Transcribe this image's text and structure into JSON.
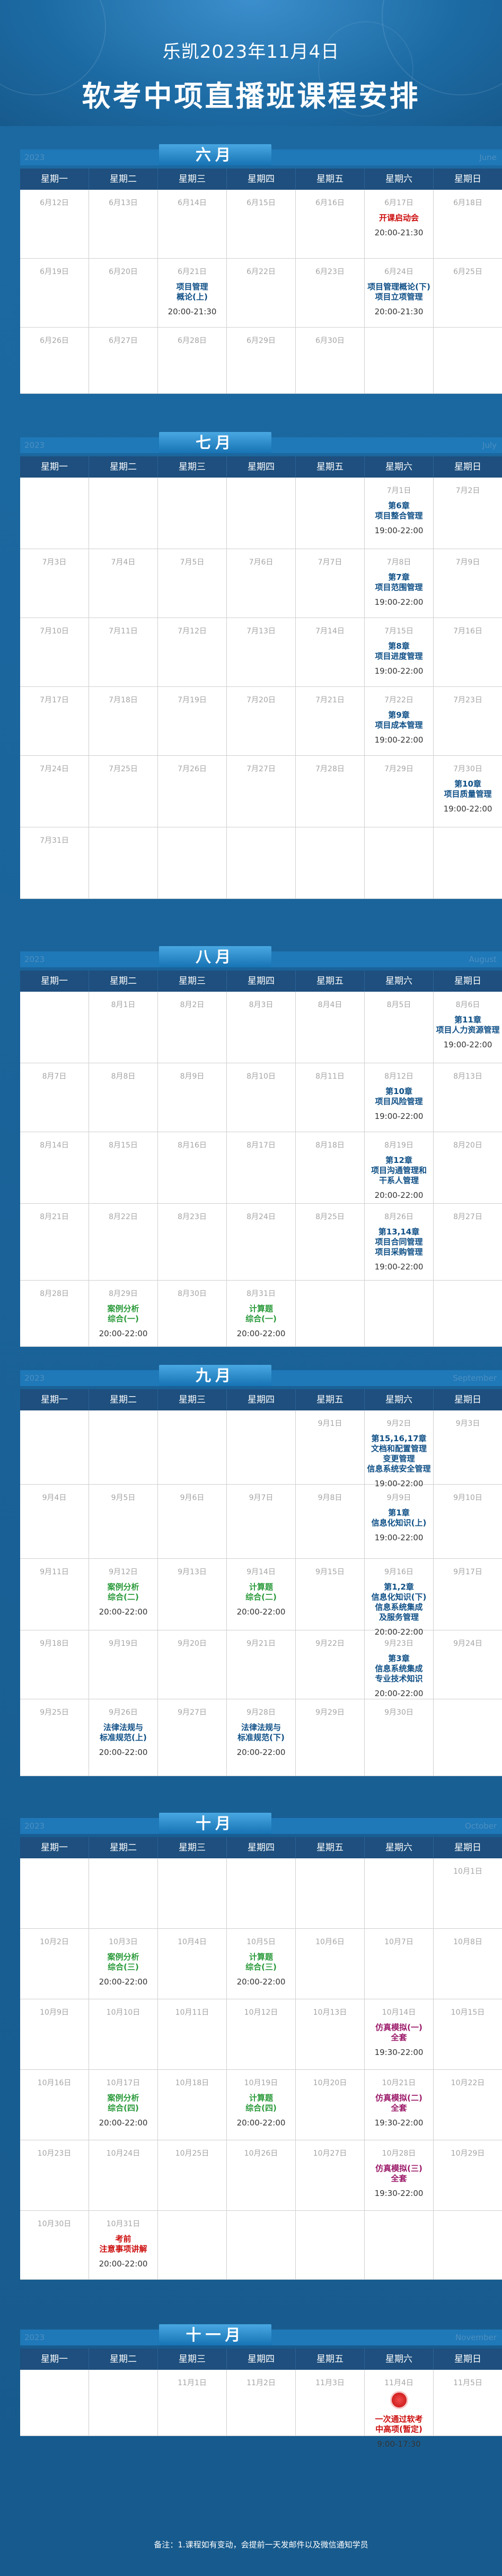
{
  "header": {
    "subtitle": "乐凯2023年11月4日",
    "title": "软考中项直播班课程安排"
  },
  "weekdays": [
    "星期一",
    "星期二",
    "星期三",
    "星期四",
    "星期五",
    "星期六",
    "星期日"
  ],
  "months": [
    {
      "id": "june",
      "name": "六月",
      "year": "2023",
      "en": "June",
      "rows": [
        [
          {
            "d": "6月12日"
          },
          {
            "d": "6月13日"
          },
          {
            "d": "6月14日"
          },
          {
            "d": "6月15日"
          },
          {
            "d": "6月16日"
          },
          {
            "d": "6月17日",
            "ev": "开课启动会",
            "c": "red",
            "t": "20:00-21:30"
          },
          {
            "d": "6月18日"
          }
        ],
        [
          {
            "d": "6月19日"
          },
          {
            "d": "6月20日"
          },
          {
            "d": "6月21日",
            "ev": "项目管理\n概论(上)",
            "c": "blue",
            "t": "20:00-21:30"
          },
          {
            "d": "6月22日"
          },
          {
            "d": "6月23日"
          },
          {
            "d": "6月24日",
            "ev": "项目管理概论(下)\n项目立项管理",
            "c": "blue",
            "t": "20:00-21:30"
          },
          {
            "d": "6月25日"
          }
        ],
        [
          {
            "d": "6月26日"
          },
          {
            "d": "6月27日"
          },
          {
            "d": "6月28日"
          },
          {
            "d": "6月29日"
          },
          {
            "d": "6月30日"
          },
          {},
          {}
        ]
      ]
    },
    {
      "id": "july",
      "name": "七月",
      "year": "2023",
      "en": "July",
      "rows": [
        [
          {},
          {},
          {},
          {},
          {},
          {
            "d": "7月1日",
            "ev": "第6章\n项目整合管理",
            "c": "blue",
            "t": "19:00-22:00"
          },
          {
            "d": "7月2日"
          }
        ],
        [
          {
            "d": "7月3日"
          },
          {
            "d": "7月4日"
          },
          {
            "d": "7月5日"
          },
          {
            "d": "7月6日"
          },
          {
            "d": "7月7日"
          },
          {
            "d": "7月8日",
            "ev": "第7章\n项目范围管理",
            "c": "blue",
            "t": "19:00-22:00"
          },
          {
            "d": "7月9日"
          }
        ],
        [
          {
            "d": "7月10日"
          },
          {
            "d": "7月11日"
          },
          {
            "d": "7月12日"
          },
          {
            "d": "7月13日"
          },
          {
            "d": "7月14日"
          },
          {
            "d": "7月15日",
            "ev": "第8章\n项目进度管理",
            "c": "blue",
            "t": "19:00-22:00"
          },
          {
            "d": "7月16日"
          }
        ],
        [
          {
            "d": "7月17日"
          },
          {
            "d": "7月18日"
          },
          {
            "d": "7月19日"
          },
          {
            "d": "7月20日"
          },
          {
            "d": "7月21日"
          },
          {
            "d": "7月22日",
            "ev": "第9章\n项目成本管理",
            "c": "blue",
            "t": "19:00-22:00"
          },
          {
            "d": "7月23日"
          }
        ],
        [
          {
            "d": "7月24日"
          },
          {
            "d": "7月25日"
          },
          {
            "d": "7月26日"
          },
          {
            "d": "7月27日"
          },
          {
            "d": "7月28日"
          },
          {
            "d": "7月29日"
          },
          {
            "d": "7月30日",
            "ev": "第10章\n项目质量管理",
            "c": "blue",
            "t": "19:00-22:00"
          }
        ],
        [
          {
            "d": "7月31日"
          },
          {},
          {},
          {},
          {},
          {},
          {}
        ]
      ]
    },
    {
      "id": "august",
      "name": "八月",
      "year": "2023",
      "en": "August",
      "rows": [
        [
          {},
          {
            "d": "8月1日"
          },
          {
            "d": "8月2日"
          },
          {
            "d": "8月3日"
          },
          {
            "d": "8月4日"
          },
          {
            "d": "8月5日"
          },
          {
            "d": "8月6日",
            "ev": "第11章\n项目人力资源管理",
            "c": "blue",
            "t": "19:00-22:00"
          }
        ],
        [
          {
            "d": "8月7日"
          },
          {
            "d": "8月8日"
          },
          {
            "d": "8月9日"
          },
          {
            "d": "8月10日"
          },
          {
            "d": "8月11日"
          },
          {
            "d": "8月12日",
            "ev": "第10章\n项目风险管理",
            "c": "blue",
            "t": "19:00-22:00"
          },
          {
            "d": "8月13日"
          }
        ],
        [
          {
            "d": "8月14日"
          },
          {
            "d": "8月15日"
          },
          {
            "d": "8月16日"
          },
          {
            "d": "8月17日"
          },
          {
            "d": "8月18日"
          },
          {
            "d": "8月19日",
            "ev": "第12章\n项目沟通管理和\n干系人管理",
            "c": "blue",
            "t": "20:00-22:00"
          },
          {
            "d": "8月20日"
          }
        ],
        [
          {
            "d": "8月21日"
          },
          {
            "d": "8月22日"
          },
          {
            "d": "8月23日"
          },
          {
            "d": "8月24日"
          },
          {
            "d": "8月25日"
          },
          {
            "d": "8月26日",
            "ev": "第13,14章\n项目合同管理\n项目采购管理",
            "c": "blue",
            "t": "19:00-22:00"
          },
          {
            "d": "8月27日"
          }
        ],
        [
          {
            "d": "8月28日"
          },
          {
            "d": "8月29日",
            "ev": "案例分析\n综合(一)",
            "c": "green",
            "t": "20:00-22:00"
          },
          {
            "d": "8月30日"
          },
          {
            "d": "8月31日",
            "ev": "计算题\n综合(一)",
            "c": "green",
            "t": "20:00-22:00"
          },
          {},
          {},
          {}
        ]
      ]
    },
    {
      "id": "september",
      "name": "九月",
      "year": "2023",
      "en": "September",
      "rows": [
        [
          {},
          {},
          {},
          {},
          {
            "d": "9月1日"
          },
          {
            "d": "9月2日",
            "ev": "第15,16,17章\n文档和配置管理\n变更管理\n信息系统安全管理",
            "c": "blue",
            "t": "19:00-22:00"
          },
          {
            "d": "9月3日"
          }
        ],
        [
          {
            "d": "9月4日"
          },
          {
            "d": "9月5日"
          },
          {
            "d": "9月6日"
          },
          {
            "d": "9月7日"
          },
          {
            "d": "9月8日"
          },
          {
            "d": "9月9日",
            "ev": "第1章\n信息化知识(上)",
            "c": "blue",
            "t": "19:00-22:00"
          },
          {
            "d": "9月10日"
          }
        ],
        [
          {
            "d": "9月11日"
          },
          {
            "d": "9月12日",
            "ev": "案例分析\n综合(二)",
            "c": "green",
            "t": "20:00-22:00"
          },
          {
            "d": "9月13日"
          },
          {
            "d": "9月14日",
            "ev": "计算题\n综合(二)",
            "c": "green",
            "t": "20:00-22:00"
          },
          {
            "d": "9月15日"
          },
          {
            "d": "9月16日",
            "ev": "第1,2章\n信息化知识(下)\n信息系统集成\n及服务管理",
            "c": "blue",
            "t": "20:00-22:00"
          },
          {
            "d": "9月17日"
          }
        ],
        [
          {
            "d": "9月18日"
          },
          {
            "d": "9月19日"
          },
          {
            "d": "9月20日"
          },
          {
            "d": "9月21日"
          },
          {
            "d": "9月22日"
          },
          {
            "d": "9月23日",
            "ev": "第3章\n信息系统集成\n专业技术知识",
            "c": "blue",
            "t": "20:00-22:00"
          },
          {
            "d": "9月24日"
          }
        ],
        [
          {
            "d": "9月25日"
          },
          {
            "d": "9月26日",
            "ev": "法律法规与\n标准规范(上)",
            "c": "blue",
            "t": "20:00-22:00"
          },
          {
            "d": "9月27日"
          },
          {
            "d": "9月28日",
            "ev": "法律法规与\n标准规范(下)",
            "c": "blue",
            "t": "20:00-22:00"
          },
          {
            "d": "9月29日"
          },
          {
            "d": "9月30日"
          },
          {}
        ]
      ]
    },
    {
      "id": "october",
      "name": "十月",
      "year": "2023",
      "en": "October",
      "rows": [
        [
          {},
          {},
          {},
          {},
          {},
          {},
          {
            "d": "10月1日"
          }
        ],
        [
          {
            "d": "10月2日"
          },
          {
            "d": "10月3日",
            "ev": "案例分析\n综合(三)",
            "c": "green",
            "t": "20:00-22:00"
          },
          {
            "d": "10月4日"
          },
          {
            "d": "10月5日",
            "ev": "计算题\n综合(三)",
            "c": "green",
            "t": "20:00-22:00"
          },
          {
            "d": "10月6日"
          },
          {
            "d": "10月7日"
          },
          {
            "d": "10月8日"
          }
        ],
        [
          {
            "d": "10月9日"
          },
          {
            "d": "10月10日"
          },
          {
            "d": "10月11日"
          },
          {
            "d": "10月12日"
          },
          {
            "d": "10月13日"
          },
          {
            "d": "10月14日",
            "ev": "仿真模拟(一)\n全套",
            "c": "purple",
            "t": "19:30-22:00"
          },
          {
            "d": "10月15日"
          }
        ],
        [
          {
            "d": "10月16日"
          },
          {
            "d": "10月17日",
            "ev": "案例分析\n综合(四)",
            "c": "green",
            "t": "20:00-22:00"
          },
          {
            "d": "10月18日"
          },
          {
            "d": "10月19日",
            "ev": "计算题\n综合(四)",
            "c": "green",
            "t": "20:00-22:00"
          },
          {
            "d": "10月20日"
          },
          {
            "d": "10月21日",
            "ev": "仿真模拟(二)\n全套",
            "c": "purple",
            "t": "19:30-22:00"
          },
          {
            "d": "10月22日"
          }
        ],
        [
          {
            "d": "10月23日"
          },
          {
            "d": "10月24日"
          },
          {
            "d": "10月25日"
          },
          {
            "d": "10月26日"
          },
          {
            "d": "10月27日"
          },
          {
            "d": "10月28日",
            "ev": "仿真模拟(三)\n全套",
            "c": "purple",
            "t": "19:30-22:00"
          },
          {
            "d": "10月29日"
          }
        ],
        [
          {
            "d": "10月30日"
          },
          {
            "d": "10月31日",
            "ev": "考前\n注意事项讲解",
            "c": "red",
            "t": "20:00-22:00"
          },
          {},
          {},
          {},
          {},
          {}
        ]
      ]
    },
    {
      "id": "november",
      "name": "十一月",
      "year": "2023",
      "en": "November",
      "rows": [
        [
          {},
          {},
          {
            "d": "11月1日"
          },
          {
            "d": "11月2日"
          },
          {
            "d": "11月3日"
          },
          {
            "d": "11月4日",
            "ev": "一次通过软考\n中高项(暂定)",
            "c": "red",
            "t": "9:00-17:30",
            "badge": true
          },
          {
            "d": "11月5日"
          }
        ]
      ]
    }
  ],
  "footer": "备注：1.课程如有变动，会提前一天发邮件以及微信通知学员"
}
